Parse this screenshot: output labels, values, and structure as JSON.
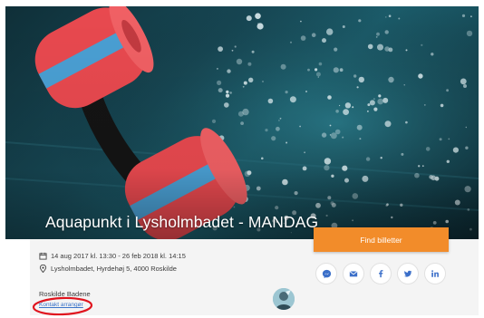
{
  "event": {
    "title": "Aquapunkt i Lysholmbadet - MANDAG",
    "date_range": "14 aug 2017 kl. 13:30 - 26 feb 2018 kl. 14:15",
    "location": "Lysholmbadet, Hyrdehøj 5, 4000 Roskilde"
  },
  "organizer": {
    "name": "Roskilde Badene",
    "contact_label": "Kontakt arrangør"
  },
  "actions": {
    "find_tickets_label": "Find billetter"
  },
  "share": [
    {
      "name": "messenger",
      "icon": "messenger-icon"
    },
    {
      "name": "email",
      "icon": "mail-icon"
    },
    {
      "name": "facebook",
      "icon": "facebook-icon"
    },
    {
      "name": "twitter",
      "icon": "twitter-icon"
    },
    {
      "name": "linkedin",
      "icon": "linkedin-icon"
    }
  ],
  "colors": {
    "accent": "#f28c2a",
    "share_icon": "#3b6fc9",
    "link": "#3a73c9",
    "highlight": "#e0141e",
    "float_red": "#e8494f",
    "float_blue": "#4a9fd3"
  }
}
